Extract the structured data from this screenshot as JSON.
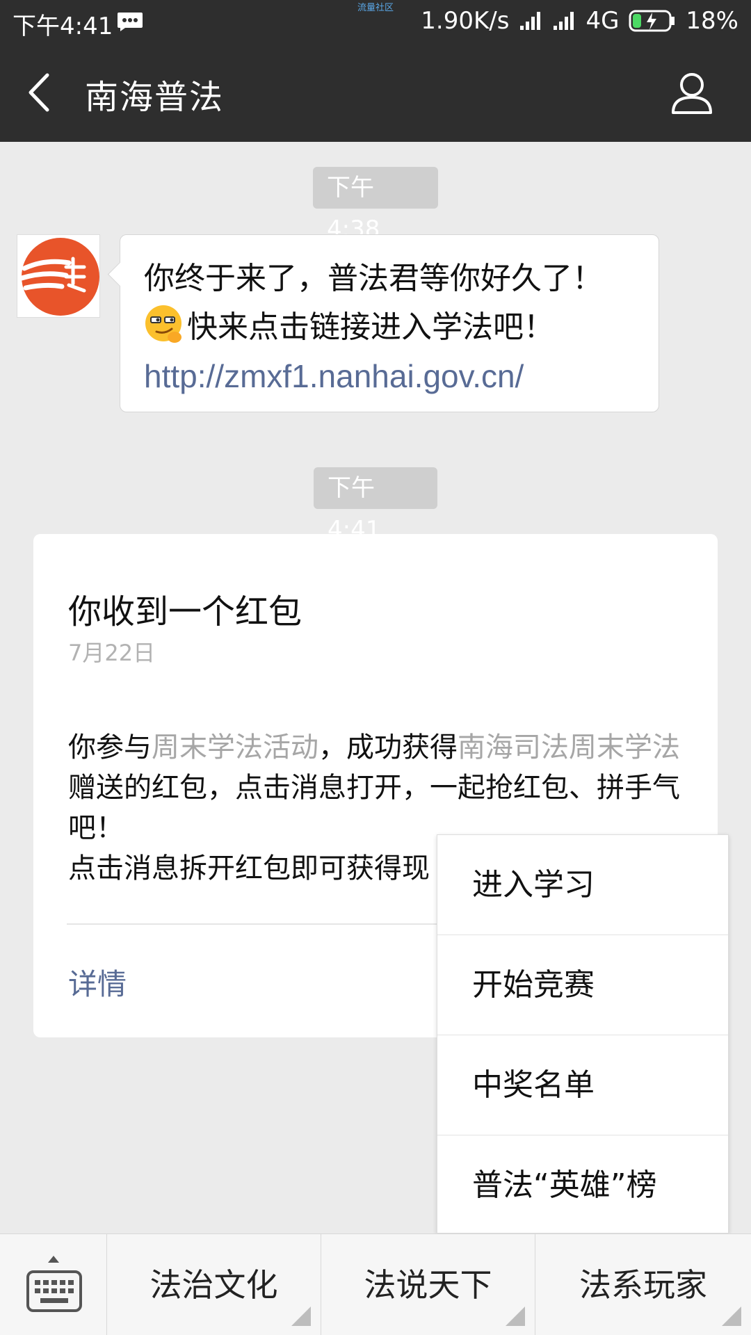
{
  "status_bar": {
    "time": "下午4:41",
    "watermark": "流量社区",
    "speed": "1.90K/s",
    "network": "4G",
    "battery": "18%"
  },
  "header": {
    "title": "南海普法"
  },
  "messages": [
    {
      "timestamp": "下午4:38",
      "line1": "你终于来了，普法君等你好久了！",
      "line2": "快来点击链接进入学法吧！",
      "link": "http://zmxf1.nanhai.gov.cn/"
    }
  ],
  "card": {
    "timestamp": "下午4:41",
    "title": "你收到一个红包",
    "date": "7月22日",
    "body_part1": "你参与",
    "body_hl1": "周末学法活动",
    "body_part2": "，成功获得",
    "body_hl2": "南海司法周末学法",
    "body_part3": "赠送的红包，点击消息打开，一起抢红包、拼手气吧！",
    "body_line2": "点击消息拆开红包即可获得现",
    "detail": "详情"
  },
  "popup_menu": {
    "items": [
      "进入学习",
      "开始竞赛",
      "中奖名单",
      "普法“英雄”榜"
    ]
  },
  "bottom_menu": {
    "tabs": [
      "法治文化",
      "法说天下",
      "法系玩家"
    ]
  },
  "colors": {
    "header_bg": "#2e2e2e",
    "chat_bg": "#ebebeb",
    "link": "#586b95",
    "logo_orange": "#e8542a"
  }
}
